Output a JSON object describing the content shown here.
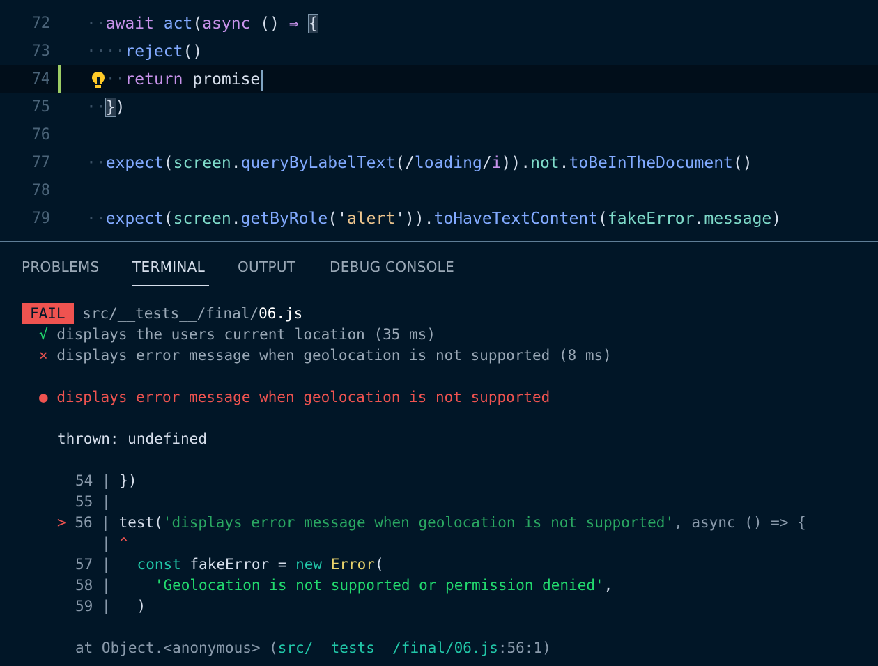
{
  "editor": {
    "lines": [
      {
        "num": "72",
        "guide": "··",
        "tokens": [
          [
            "kw",
            "await "
          ],
          [
            "fn",
            "act"
          ],
          [
            "plain",
            "("
          ],
          [
            "kw",
            "async "
          ],
          [
            "plain",
            "() "
          ],
          [
            "op",
            "⇒ "
          ]
        ],
        "brace": "{"
      },
      {
        "num": "73",
        "guide": "····",
        "tokens": [
          [
            "fn",
            "reject"
          ],
          [
            "plain",
            "()"
          ]
        ]
      },
      {
        "num": "74",
        "guide": "··",
        "tokens": [
          [
            "kw",
            "return "
          ],
          [
            "plain",
            "promise"
          ]
        ]
      },
      {
        "num": "75",
        "guide": "··",
        "brace": "}",
        "tokens": [
          [
            "plain",
            ")"
          ]
        ]
      },
      {
        "num": "76",
        "guide": "",
        "tokens": []
      },
      {
        "num": "77",
        "guide": "··",
        "tokens": [
          [
            "fn",
            "expect"
          ],
          [
            "plain",
            "("
          ],
          [
            "prop",
            "screen"
          ],
          [
            "plain",
            "."
          ],
          [
            "fn",
            "queryByLabelText"
          ],
          [
            "plain",
            "(/"
          ],
          [
            "fn",
            "loading"
          ],
          [
            "plain",
            "/"
          ],
          [
            "kw",
            "i"
          ],
          [
            "plain",
            "))"
          ],
          [
            "plain",
            "."
          ],
          [
            "prop",
            "not"
          ],
          [
            "plain",
            "."
          ],
          [
            "fn",
            "toBeInTheDocument"
          ],
          [
            "plain",
            "()"
          ]
        ]
      },
      {
        "num": "78",
        "guide": "",
        "tokens": []
      },
      {
        "num": "79",
        "guide": "··",
        "tokens": [
          [
            "fn",
            "expect"
          ],
          [
            "plain",
            "("
          ],
          [
            "prop",
            "screen"
          ],
          [
            "plain",
            "."
          ],
          [
            "fn",
            "getByRole"
          ],
          [
            "plain",
            "('"
          ],
          [
            "str",
            "alert"
          ],
          [
            "plain",
            "'))"
          ],
          [
            "plain",
            "."
          ],
          [
            "fn",
            "toHaveTextContent"
          ],
          [
            "plain",
            "("
          ],
          [
            "prop",
            "fakeError"
          ],
          [
            "plain",
            "."
          ],
          [
            "prop",
            "message"
          ],
          [
            "plain",
            ")"
          ]
        ]
      }
    ]
  },
  "panel": {
    "tabs": [
      "PROBLEMS",
      "TERMINAL",
      "OUTPUT",
      "DEBUG CONSOLE"
    ],
    "active_tab": "TERMINAL"
  },
  "terminal": {
    "fail_badge": "FAIL",
    "file_prefix": "src/__tests__/final/",
    "file_name": "06.js",
    "pass_mark": "√",
    "pass_text": "displays the users current location (35 ms)",
    "fail_mark": "×",
    "fail_text": "displays error message when geolocation is not supported (8 ms)",
    "bullet": "●",
    "error_title": "displays error message when geolocation is not supported",
    "thrown_label": "thrown:",
    "thrown_value": "undefined",
    "snippet": {
      "l54_num": "54",
      "l54_code": "})",
      "l55_num": "55",
      "l56_marker": ">",
      "l56_num": "56",
      "l56_fn": "test(",
      "l56_str": "'displays error message when geolocation is not supported'",
      "l56_rest": ", async () => {",
      "caret": "^",
      "l57_num": "57",
      "l57_const": "const",
      "l57_name": " fakeError ",
      "l57_eq": "=",
      "l57_new": " new ",
      "l57_cls": "Error",
      "l57_paren": "(",
      "l58_num": "58",
      "l58_str": "'Geolocation is not supported or permission denied'",
      "l58_comma": ",",
      "l59_num": "59",
      "l59_code": ")",
      "pipe": "|"
    },
    "stack_prefix": "at Object.<anonymous> (",
    "stack_path": "src/__tests__/final/06.js",
    "stack_loc": ":56:1",
    "stack_suffix": ")"
  }
}
